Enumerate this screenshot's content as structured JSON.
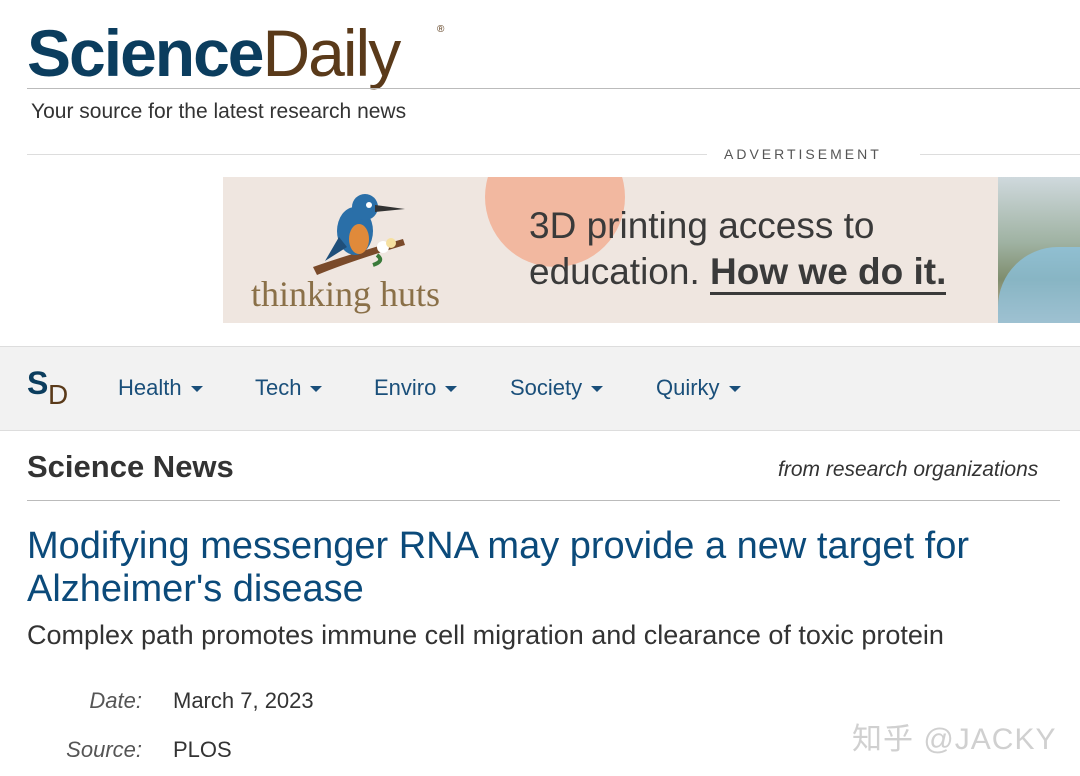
{
  "header": {
    "logo_science": "Science",
    "logo_daily": "Daily",
    "logo_reg": "®",
    "tagline": "Your source for the latest research news"
  },
  "advertisement": {
    "label": "ADVERTISEMENT",
    "brand": "thinking huts",
    "copy_line1": "3D printing access to",
    "copy_line2_plain": "education.",
    "copy_line2_bold": "How we do it."
  },
  "nav": {
    "logo_s": "S",
    "logo_d": "D",
    "items": [
      {
        "label": "Health"
      },
      {
        "label": "Tech"
      },
      {
        "label": "Enviro"
      },
      {
        "label": "Society"
      },
      {
        "label": "Quirky"
      }
    ]
  },
  "section": {
    "title": "Science News",
    "subtitle": "from research organizations"
  },
  "article": {
    "headline": "Modifying messenger RNA may provide a new target for Alzheimer's disease",
    "subheadline": "Complex path promotes immune cell migration and clearance of toxic protein",
    "date_label": "Date:",
    "date_value": "March 7, 2023",
    "source_label": "Source:",
    "source_value": "PLOS"
  },
  "watermark": "知乎 @JACKY",
  "colors": {
    "brand_blue": "#0b3d5e",
    "brand_brown": "#5a3a1a",
    "link_blue": "#1a4f7a",
    "nav_bg": "#f2f2f2"
  }
}
